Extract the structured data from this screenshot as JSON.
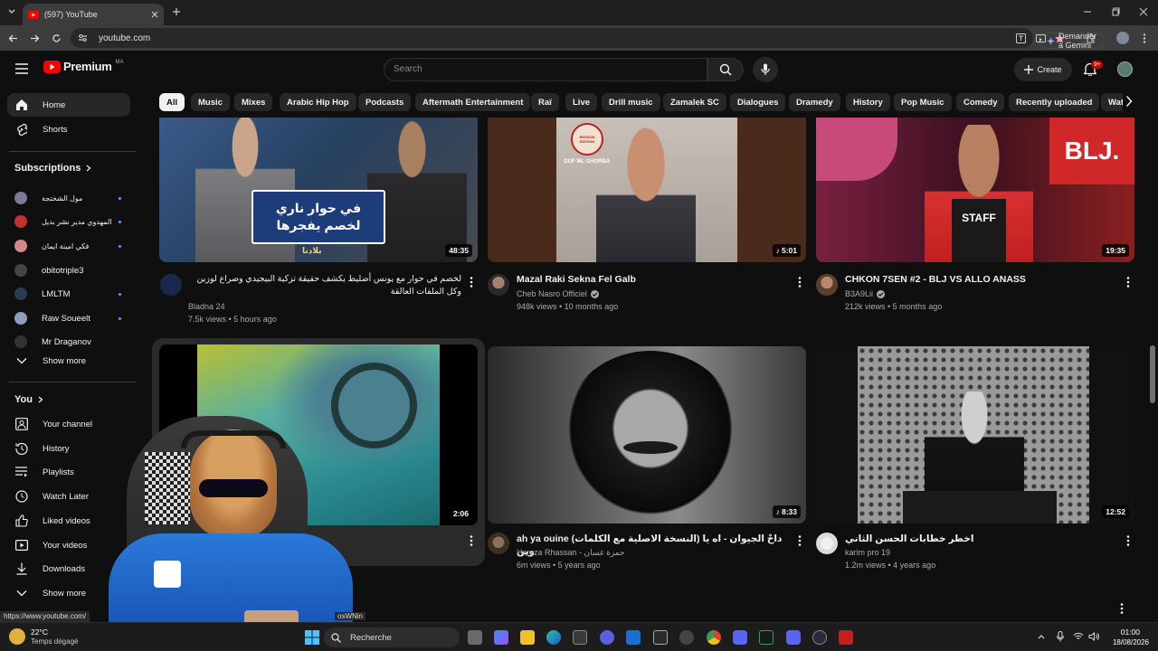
{
  "browser": {
    "tab_title": "(597) YouTube",
    "url": "youtube.com",
    "gemini_button": "Demander à Gemini",
    "status_url": "https://www.youtube.com/"
  },
  "header": {
    "logo_text": "Premium",
    "region": "MA",
    "search_placeholder": "Search",
    "create_label": "Create",
    "notif_badge": "9+"
  },
  "sidebar": {
    "main": [
      {
        "label": "Home"
      },
      {
        "label": "Shorts"
      }
    ],
    "subscriptions_title": "Subscriptions",
    "subscriptions": [
      {
        "label": "مول الشختجة",
        "dot": true,
        "color": "#7a7a9a"
      },
      {
        "label": "المهدوي مدير نشر بديل",
        "dot": true,
        "color": "#c23030"
      },
      {
        "label": "فكي امينة ايمان",
        "dot": true,
        "color": "#d08888"
      },
      {
        "label": "obitotriple3",
        "dot": false,
        "color": "#444444"
      },
      {
        "label": "LMLTM",
        "dot": true,
        "color": "#2a3a55"
      },
      {
        "label": "Raw Soueelt",
        "dot": true,
        "color": "#8aa0b8"
      },
      {
        "label": "Mr Draganov",
        "dot": false,
        "color": "#333333"
      }
    ],
    "show_more_1": "Show more",
    "you_title": "You",
    "you_items": [
      {
        "label": "Your channel"
      },
      {
        "label": "History"
      },
      {
        "label": "Playlists"
      },
      {
        "label": "Watch Later"
      },
      {
        "label": "Liked videos"
      },
      {
        "label": "Your videos"
      },
      {
        "label": "Downloads"
      }
    ],
    "show_more_2": "Show more"
  },
  "chips": [
    "All",
    "Music",
    "Mixes",
    "Arabic Hip Hop",
    "Podcasts",
    "Aftermath Entertainment",
    "Raï",
    "Live",
    "Drill music",
    "Zamalek SC",
    "Dialogues",
    "Dramedy",
    "History",
    "Pop Music",
    "Comedy",
    "Recently uploaded",
    "Wat"
  ],
  "videos": [
    {
      "title": "لخصم في حوار مع يونس أضليط يكشف حقيقة تزكية البيجيدي وصراع لوزين وكل الملفات العالقة",
      "channel": "Bladna 24",
      "meta": "7.5k views • 5 hours ago",
      "duration": "48:35",
      "overlay_text_1": "في حوار ناري",
      "overlay_text_2": "لخصم يفجرها",
      "logo_text": "بلادنا"
    },
    {
      "title": "Mazal Raki Sekna Fel Galb",
      "channel": "Cheb Nasro Officiel",
      "meta": "948k views • 10 months ago",
      "duration": "5:01",
      "logo_text": "REDSON EDITION",
      "logo_sub": "OUF ML GHORBA"
    },
    {
      "title": "CHKON 7SEN #2 - BLJ VS ALLO ANASS",
      "channel": "B3A9Lii",
      "meta": "212k views • 5 months ago",
      "duration": "19:35",
      "sign_text": "BLJ.",
      "apron_text": "STAFF"
    },
    {
      "title": "",
      "channel": "",
      "meta": "",
      "duration": "2:06"
    },
    {
      "title": "ah ya ouine (النسخة الاصلية مع الكلمات) داحْ الجيوان - اه يا وين",
      "channel": "Hamza Rhassan - حمزة غسان",
      "meta": "6m views • 5 years ago",
      "duration": "8:33"
    },
    {
      "title": "اخطر خطابات الحسن الثاني",
      "channel": "karim pro 19",
      "meta": "1.2m views • 4 years ago",
      "duration": "12:52"
    }
  ],
  "taskbar": {
    "temp": "22°C",
    "weather": "Temps dégagé",
    "search_label": "Recherche",
    "time": "01:00",
    "date": "18/08/2026",
    "fragment": "osWNin"
  },
  "colors": {
    "youtube_red": "#ff0000",
    "bg": "#0f0f0f",
    "link_blue": "#3ea6ff"
  }
}
